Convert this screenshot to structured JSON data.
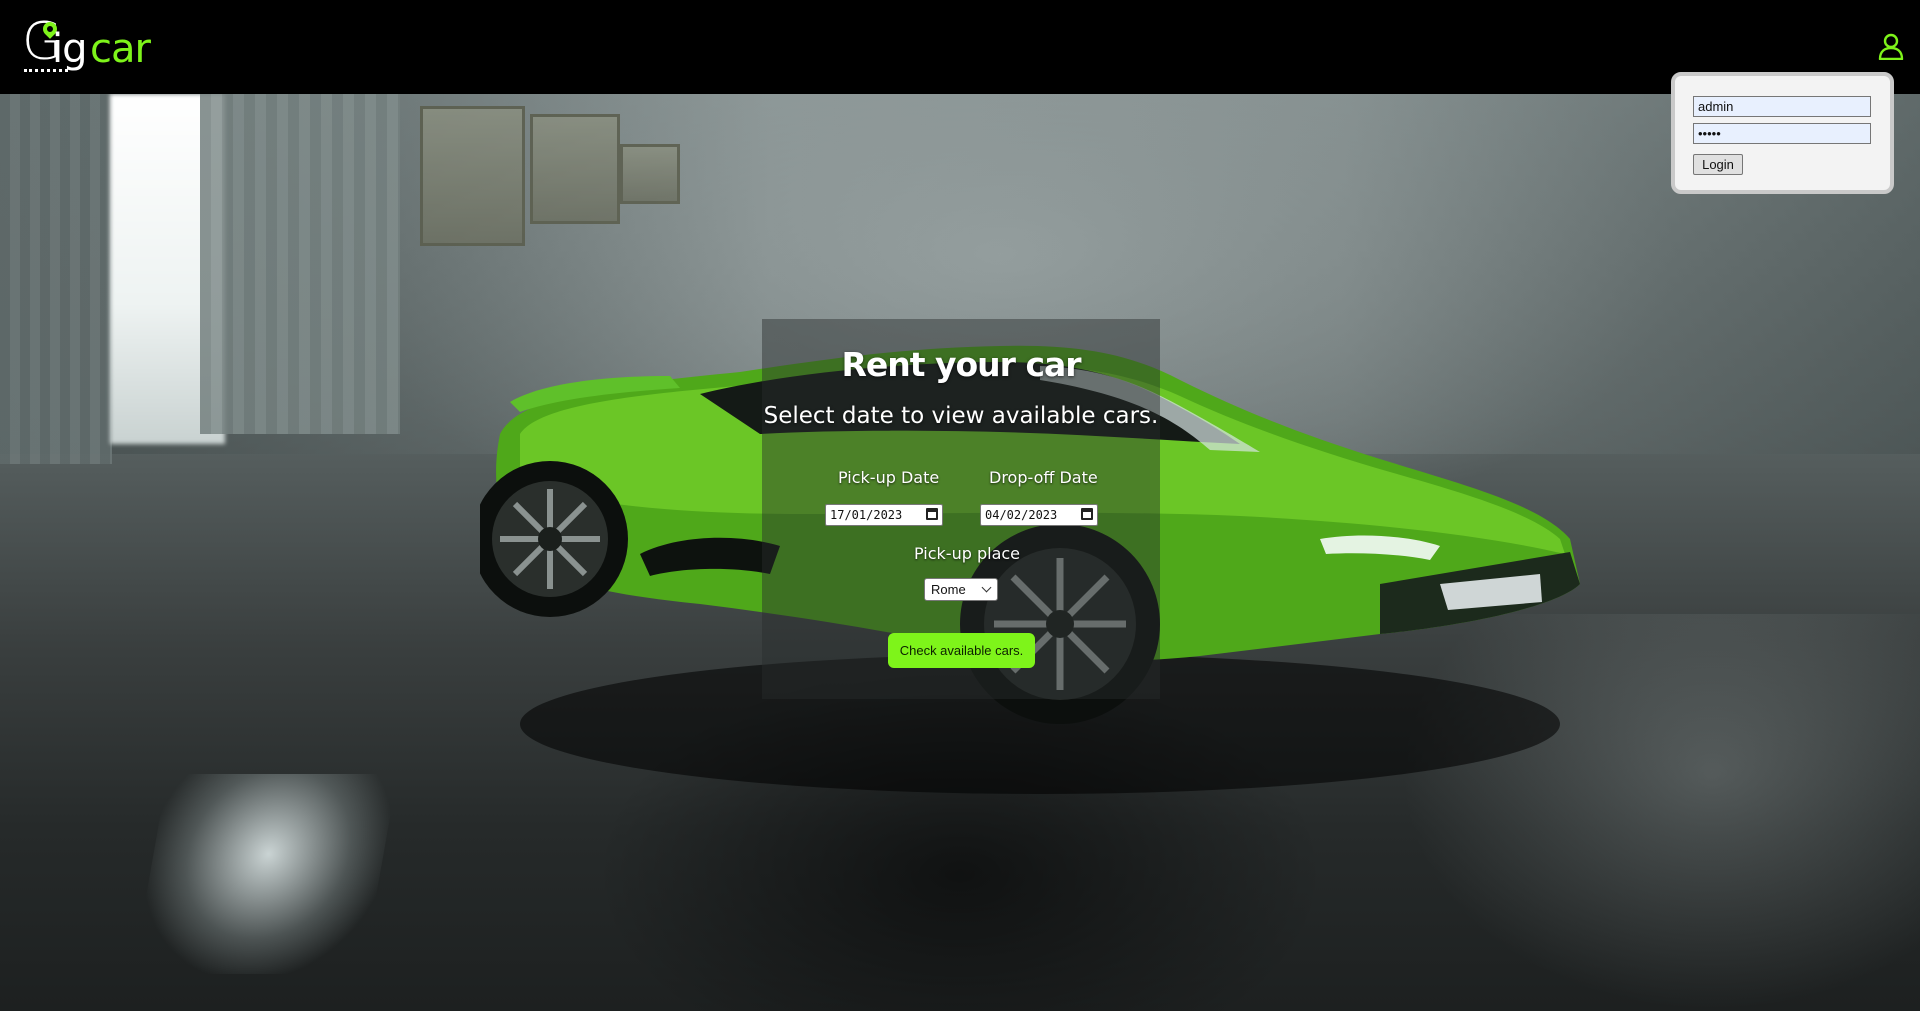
{
  "header": {
    "logo_text": "Gigcar",
    "logo_icon": "location-pin-icon",
    "user_icon": "user-icon"
  },
  "login": {
    "username_value": "admin",
    "password_value": "•••••",
    "login_label": "Login"
  },
  "rent": {
    "title": "Rent your car",
    "subtitle": "Select date to view available cars.",
    "pickup_date_label": "Pick-up Date",
    "pickup_date_value": "17/01/2023",
    "dropoff_date_label": "Drop-off Date",
    "dropoff_date_value": "04/02/2023",
    "pickup_place_label": "Pick-up place",
    "pickup_place_value": "Rome",
    "check_button_label": "Check available cars."
  },
  "colors": {
    "accent": "#7ef41a",
    "header_bg": "#000000",
    "panel_bg": "rgba(40,45,45,0.45)"
  }
}
